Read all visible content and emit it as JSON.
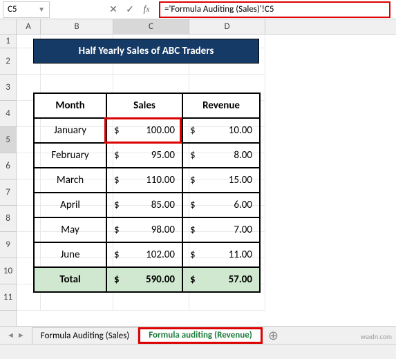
{
  "name_box": "C5",
  "formula": "='Formula Auditing (Sales)'!C5",
  "columns": [
    "A",
    "B",
    "C",
    "D"
  ],
  "rows_labels": [
    "1",
    "2",
    "3",
    "4",
    "5",
    "6",
    "7",
    "8",
    "9",
    "10",
    "11"
  ],
  "title": "Half Yearly Sales of ABC Traders",
  "headers": {
    "month": "Month",
    "sales": "Sales",
    "revenue": "Revenue"
  },
  "currency": "$",
  "data_rows": [
    {
      "month": "January",
      "sales": "100.00",
      "revenue": "10.00"
    },
    {
      "month": "February",
      "sales": "95.00",
      "revenue": "8.00"
    },
    {
      "month": "March",
      "sales": "110.00",
      "revenue": "15.00"
    },
    {
      "month": "April",
      "sales": "85.00",
      "revenue": "6.00"
    },
    {
      "month": "May",
      "sales": "98.00",
      "revenue": "7.00"
    },
    {
      "month": "June",
      "sales": "102.00",
      "revenue": "11.00"
    }
  ],
  "total": {
    "label": "Total",
    "sales": "590.00",
    "revenue": "57.00"
  },
  "tabs": {
    "sales": "Formula Auditing (Sales)",
    "revenue": "Formula auditing (Revenue)"
  },
  "watermark": "wsxdn.com",
  "chart_data": {
    "type": "table",
    "title": "Half Yearly Sales of ABC Traders",
    "columns": [
      "Month",
      "Sales",
      "Revenue"
    ],
    "rows": [
      [
        "January",
        100.0,
        10.0
      ],
      [
        "February",
        95.0,
        8.0
      ],
      [
        "March",
        110.0,
        15.0
      ],
      [
        "April",
        85.0,
        6.0
      ],
      [
        "May",
        98.0,
        7.0
      ],
      [
        "June",
        102.0,
        11.0
      ],
      [
        "Total",
        590.0,
        57.0
      ]
    ]
  }
}
